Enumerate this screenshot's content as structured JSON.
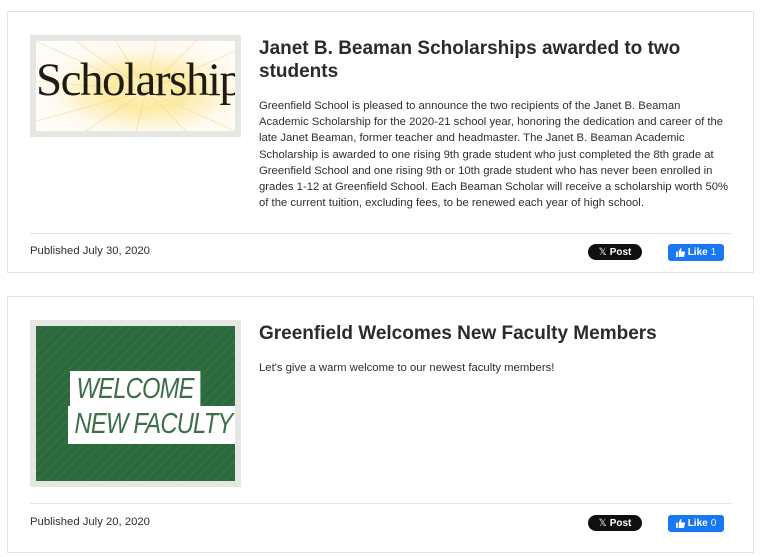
{
  "posts": [
    {
      "image": {
        "text": "Scholarships",
        "colors": {
          "ink": "#1f1b12",
          "burst": "#fbeaa2",
          "frame": "#e6e6e3"
        }
      },
      "title": "Janet B. Beaman Scholarships awarded to two students",
      "body": "Greenfield School is pleased to announce the two recipients of the Janet B. Beaman Academic Scholarship for the 2020-21 school year, honoring the dedication and career of the late Janet Beaman, former teacher and headmaster. The Janet B. Beaman Academic Scholarship is awarded to one rising 9th grade student who just completed the 8th grade at Greenfield School and one rising 9th or 10th grade student who has never been enrolled in grades 1-12 at Greenfield School. Each Beaman Scholar will receive a scholarship worth 50% of the current tuition, excluding fees, to be renewed each year of high school.",
      "published": "Published July 30, 2020",
      "x_post_label": "Post",
      "fb_like_label": "Like",
      "fb_like_count": "1"
    },
    {
      "image": {
        "line1": "WELCOME",
        "line2": "NEW FACULTY",
        "colors": {
          "background": "#2a6a3c",
          "ink": "#3d6e47",
          "frame": "#e6e6e3"
        }
      },
      "title": "Greenfield Welcomes New Faculty Members",
      "body": "Let's give a warm welcome to our newest faculty members!",
      "published": "Published July 20, 2020",
      "x_post_label": "Post",
      "fb_like_label": "Like",
      "fb_like_count": "0"
    }
  ],
  "icons": {
    "x_icon": "x-logo-icon",
    "like_icon": "thumbs-up-icon"
  },
  "colors": {
    "x_button": "#0f0f0f",
    "fb_button": "#1877f2",
    "divider": "#e4e4e4"
  }
}
